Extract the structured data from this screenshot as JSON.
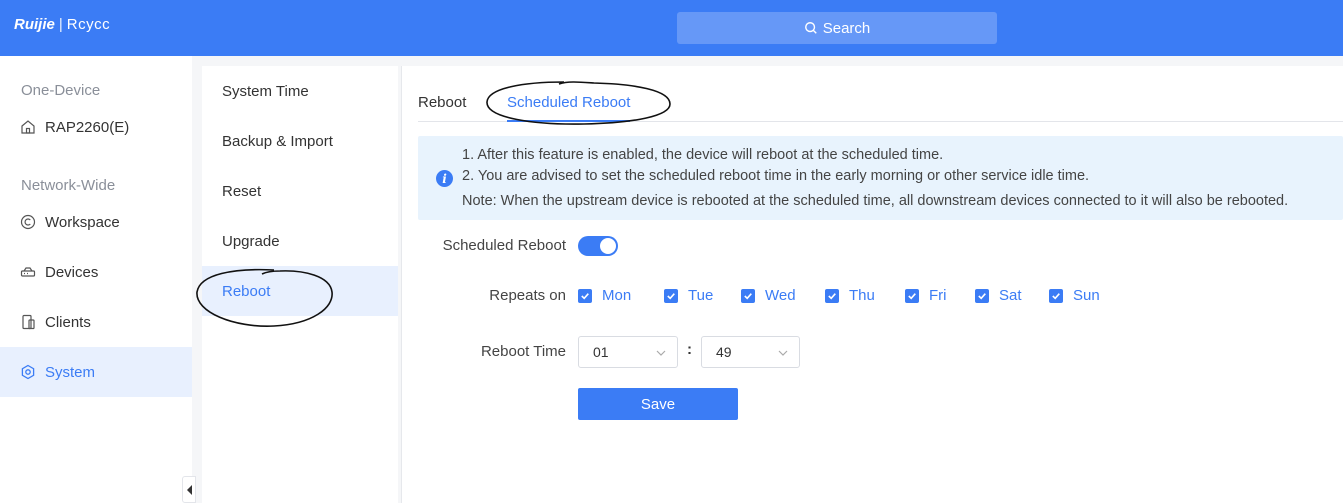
{
  "header": {
    "logo_brand": "Ruijie",
    "logo_sep": "|",
    "logo_product": "Rcycc",
    "search_label": "Search"
  },
  "leftnav": {
    "section_one_device": "One-Device",
    "device_name": "RAP2260(E)",
    "section_network_wide": "Network-Wide",
    "items": [
      {
        "label": "Workspace",
        "icon": "copyright-circle-icon"
      },
      {
        "label": "Devices",
        "icon": "router-icon"
      },
      {
        "label": "Clients",
        "icon": "phone-icon"
      },
      {
        "label": "System",
        "icon": "hexagon-gear-icon",
        "active": true
      }
    ]
  },
  "submenu": {
    "items": [
      {
        "label": "System Time"
      },
      {
        "label": "Backup & Import"
      },
      {
        "label": "Reset"
      },
      {
        "label": "Upgrade"
      },
      {
        "label": "Reboot",
        "active": true
      }
    ]
  },
  "tabs": [
    {
      "label": "Reboot"
    },
    {
      "label": "Scheduled Reboot",
      "active": true
    }
  ],
  "info": {
    "line1": "1. After this feature is enabled, the device will reboot at the scheduled time.",
    "line2": "2. You are advised to set the scheduled reboot time in the early morning or other service idle time.",
    "note": "Note: When the upstream device is rebooted at the scheduled time, all downstream devices connected to it will also be rebooted."
  },
  "form": {
    "scheduled_reboot_label": "Scheduled Reboot",
    "scheduled_reboot_enabled": true,
    "repeats_label": "Repeats on",
    "days": [
      {
        "label": "Mon",
        "checked": true
      },
      {
        "label": "Tue",
        "checked": true
      },
      {
        "label": "Wed",
        "checked": true
      },
      {
        "label": "Thu",
        "checked": true
      },
      {
        "label": "Fri",
        "checked": true
      },
      {
        "label": "Sat",
        "checked": true
      },
      {
        "label": "Sun",
        "checked": true
      }
    ],
    "reboot_time_label": "Reboot Time",
    "hour": "01",
    "colon": ":",
    "minute": "49",
    "save_label": "Save"
  },
  "colors": {
    "accent": "#3b7cf5",
    "active_bg": "#e8f0fe",
    "info_bg": "#e8f3fd"
  }
}
